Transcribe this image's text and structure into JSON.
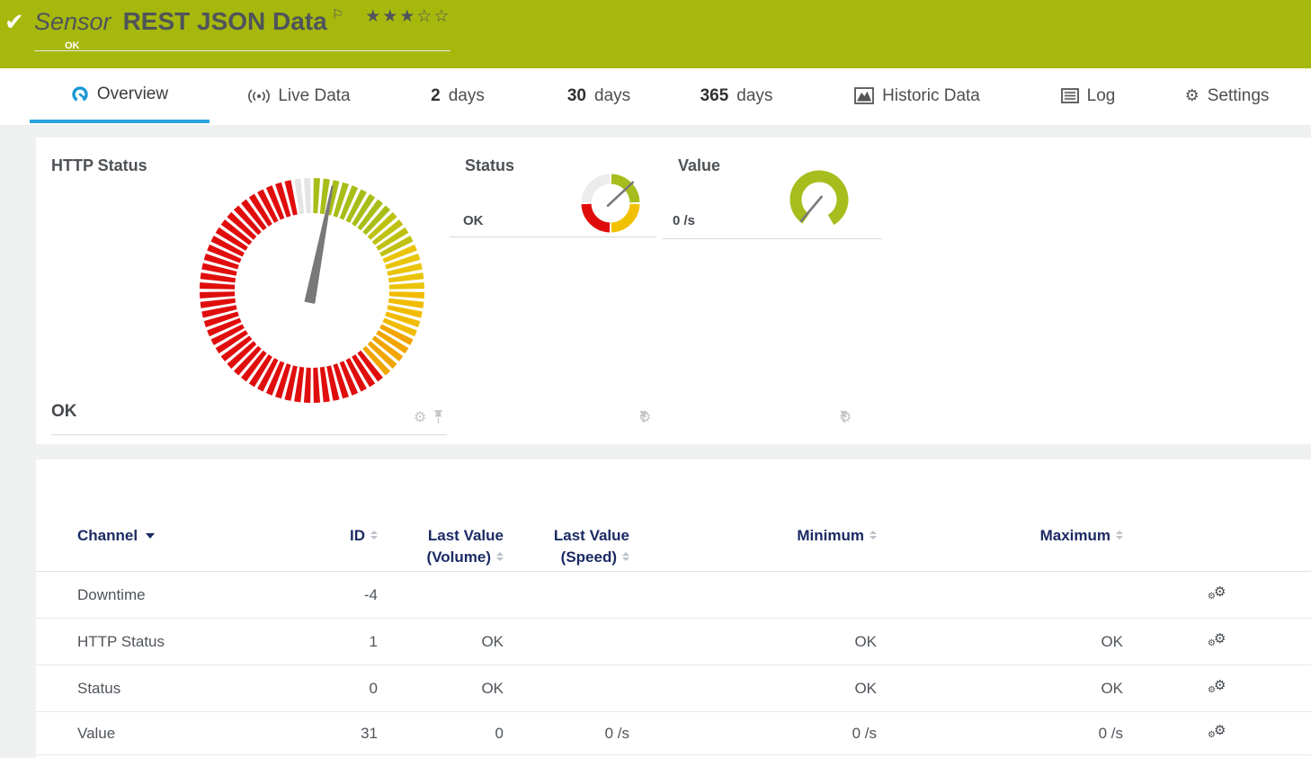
{
  "header": {
    "kind": "Sensor",
    "title": "REST JSON Data",
    "status": "OK",
    "stars": "★★★☆☆",
    "check_icon": "✔",
    "flag_icon": "⚐"
  },
  "tabs": {
    "overview": {
      "label": "Overview"
    },
    "live_data": {
      "label": "Live Data"
    },
    "days2": {
      "num": "2",
      "unit": "days"
    },
    "days30": {
      "num": "30",
      "unit": "days"
    },
    "days365": {
      "num": "365",
      "unit": "days"
    },
    "historic": {
      "label": "Historic Data"
    },
    "log": {
      "label": "Log"
    },
    "settings": {
      "label": "Settings"
    }
  },
  "panels": {
    "http_status": {
      "title": "HTTP Status",
      "value": "OK"
    },
    "status": {
      "title": "Status",
      "value": "OK"
    },
    "value": {
      "title": "Value",
      "value": "0 /s"
    }
  },
  "gauges": {
    "http_status": {
      "needle_deg": 11
    },
    "status": {
      "needle_deg": 47
    },
    "value": {
      "needle_deg": 220,
      "arc_start_deg": 215,
      "arc_end_deg": 510
    }
  },
  "icons": {
    "gear": "⚙"
  },
  "table": {
    "headers": {
      "channel": "Channel",
      "id": "ID",
      "last_volume_line1": "Last Value",
      "last_volume_line2": "(Volume)",
      "last_speed_line1": "Last Value",
      "last_speed_line2": "(Speed)",
      "minimum": "Minimum",
      "maximum": "Maximum"
    },
    "rows": [
      {
        "channel": "Downtime",
        "id": "-4",
        "last_volume": "",
        "last_speed": "",
        "minimum": "",
        "maximum": ""
      },
      {
        "channel": "HTTP Status",
        "id": "1",
        "last_volume": "OK",
        "last_speed": "",
        "minimum": "OK",
        "maximum": "OK"
      },
      {
        "channel": "Status",
        "id": "0",
        "last_volume": "OK",
        "last_speed": "",
        "minimum": "OK",
        "maximum": "OK"
      },
      {
        "channel": "Value",
        "id": "31",
        "last_volume": "0",
        "last_speed": "0 /s",
        "minimum": "0 /s",
        "maximum": "0 /s"
      }
    ]
  },
  "colors": {
    "header_green": "#a7b80c",
    "accent_blue": "#2ba3dc",
    "navy": "#1b2a63",
    "gauge_green": "#a9bd18",
    "gauge_green2": "#bfc112",
    "gauge_gold": "#e9c40a",
    "gauge_amber": "#f0bb00",
    "gauge_orange": "#f0a500",
    "gauge_red": "#e00d0d",
    "gauge_gray": "#e4e4e4",
    "needle_gray": "#787878",
    "mini_gray": "#ececec",
    "mini_green": "#a6bd1d",
    "mini_yellow": "#f0c101",
    "mini_red": "#e00c0c"
  }
}
